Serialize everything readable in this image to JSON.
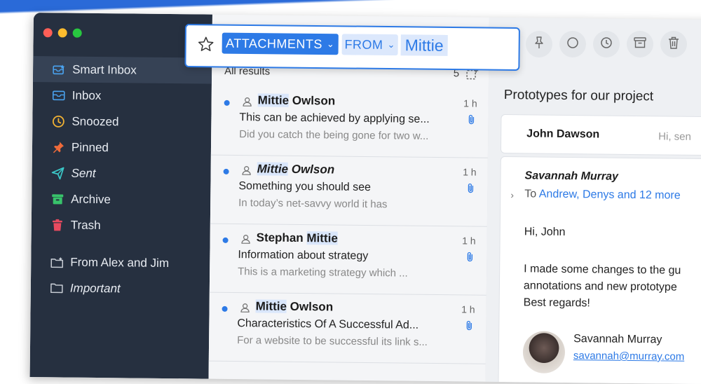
{
  "search": {
    "filter_attachments": "ATTACHMENTS",
    "filter_from": "FROM",
    "query": "Mittie"
  },
  "sidebar": {
    "items": [
      {
        "label": "Smart Inbox",
        "icon": "smart-inbox-icon"
      },
      {
        "label": "Inbox",
        "icon": "inbox-icon"
      },
      {
        "label": "Snoozed",
        "icon": "clock-icon"
      },
      {
        "label": "Pinned",
        "icon": "pin-icon"
      },
      {
        "label": "Sent",
        "icon": "send-icon"
      },
      {
        "label": "Archive",
        "icon": "archive-icon"
      },
      {
        "label": "Trash",
        "icon": "trash-icon"
      },
      {
        "label": "From Alex and Jim",
        "icon": "smart-folder-icon"
      },
      {
        "label": "Important",
        "icon": "folder-icon"
      }
    ]
  },
  "list": {
    "header": "All results",
    "count": "5",
    "messages": [
      {
        "from_a": "Mittie",
        "from_b": " Owlson",
        "subject": "This can be achieved by applying se...",
        "preview": "Did you catch the being gone for two w...",
        "time": "1 h"
      },
      {
        "from_a": "Mittie",
        "from_b": " Owlson",
        "subject": "Something you should see",
        "preview": "In today’s net-savvy world it has",
        "time": "1 h"
      },
      {
        "from_a": "Stephan ",
        "from_b": "Mittie",
        "subject": "Information about strategy",
        "preview": "This is a marketing strategy which ...",
        "time": "1 h"
      },
      {
        "from_a": "Mittie",
        "from_b": " Owlson",
        "subject": "Characteristics Of A Successful Ad...",
        "preview": "For a website to be successful its link s...",
        "time": "1 h"
      }
    ]
  },
  "reader": {
    "title": "Prototypes for our project",
    "thread1": {
      "from": "John Dawson",
      "preview": "Hi, sen"
    },
    "thread2": {
      "from": "Savannah Murray",
      "to_label": "To ",
      "recipients": "Andrew, Denys and 12 more",
      "greeting": "Hi, John",
      "body_line1": "I made some changes to the gu",
      "body_line2": "annotations and new prototype",
      "body_line3": "Best regards!",
      "sig_name": "Savannah Murray",
      "sig_email": "savannah@murray.com"
    }
  },
  "colors": {
    "accent": "#2d7ae6",
    "sidebar": "#263040"
  }
}
